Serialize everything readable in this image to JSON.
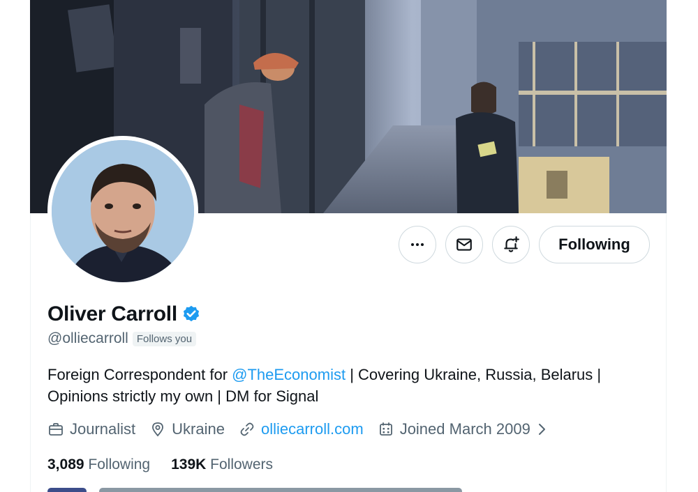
{
  "profile": {
    "name": "Oliver Carroll",
    "handle": "@olliecarroll",
    "follows_you_label": "Follows you",
    "bio_part1": "Foreign Correspondent for ",
    "bio_mention": "@TheEconomist",
    "bio_part2": " | Covering Ukraine, Russia, Belarus | Opinions strictly my own | DM for Signal",
    "verified_color": "#1d9bf0"
  },
  "actions": {
    "more_icon": "more-icon",
    "message_icon": "envelope-icon",
    "notify_icon": "bell-plus-icon",
    "follow_label": "Following"
  },
  "meta": {
    "profession": "Journalist",
    "location": "Ukraine",
    "website": "olliecarroll.com",
    "joined": "Joined March 2009"
  },
  "stats": {
    "following_count": "3,089",
    "following_label": " Following",
    "followers_count": "139K",
    "followers_label": " Followers"
  },
  "colors": {
    "accent": "#1d9bf0",
    "text": "#0f1419",
    "secondary": "#536471",
    "border": "#cfd9de"
  }
}
